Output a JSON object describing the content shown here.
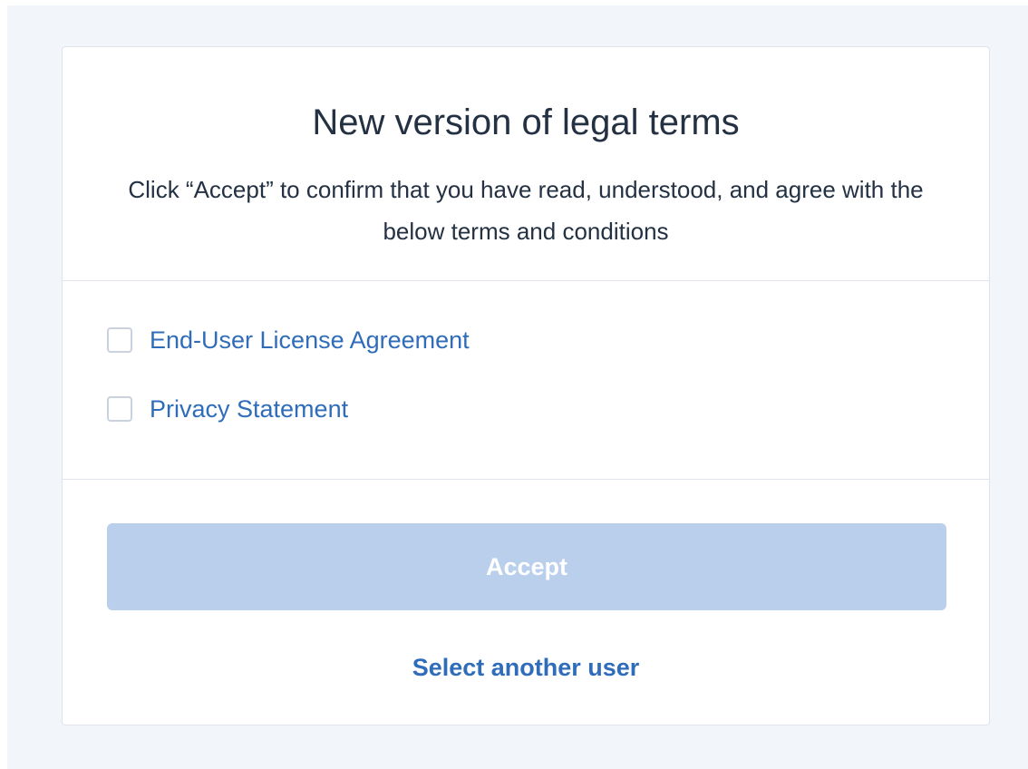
{
  "dialog": {
    "title": "New version of legal terms",
    "subtitle": "Click “Accept” to confirm that you have read, understood, and agree with the below terms and conditions"
  },
  "terms": [
    {
      "label": "End-User License Agreement",
      "checked": false
    },
    {
      "label": "Privacy Statement",
      "checked": false
    }
  ],
  "actions": {
    "accept_label": "Accept",
    "accept_enabled": false,
    "select_user_label": "Select another user"
  },
  "colors": {
    "page_background": "#f2f5fa",
    "link": "#2f6cb9",
    "button_disabled": "#b9cfeb",
    "text": "#243143",
    "border": "#dfe4ec"
  }
}
